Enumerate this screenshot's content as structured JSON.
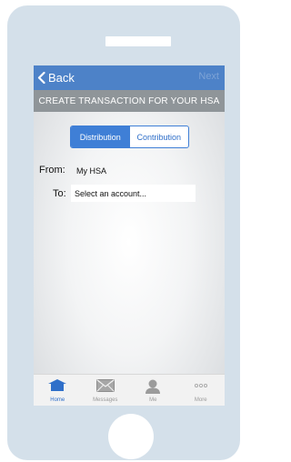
{
  "navbar": {
    "back_label": "Back",
    "next_label": "Next"
  },
  "title": "CREATE TRANSACTION FOR YOUR HSA",
  "segmented": {
    "distribution_label": "Distribution",
    "contribution_label": "Contribution",
    "selected": "Distribution"
  },
  "form": {
    "from_label": "From:",
    "from_value": "My HSA",
    "to_label": "To:",
    "to_placeholder": "Select an account..."
  },
  "tabbar": {
    "tabs": [
      {
        "label": "Home",
        "icon": "home-icon",
        "active": true
      },
      {
        "label": "Messages",
        "icon": "envelope-icon",
        "active": false
      },
      {
        "label": "Me",
        "icon": "person-icon",
        "active": false
      },
      {
        "label": "More",
        "icon": "ellipsis-icon",
        "active": false
      }
    ]
  },
  "colors": {
    "navbar": "#4d82c8",
    "titlebar": "#8f9599",
    "accent": "#3f7fd6",
    "device": "#d4e0ea"
  }
}
